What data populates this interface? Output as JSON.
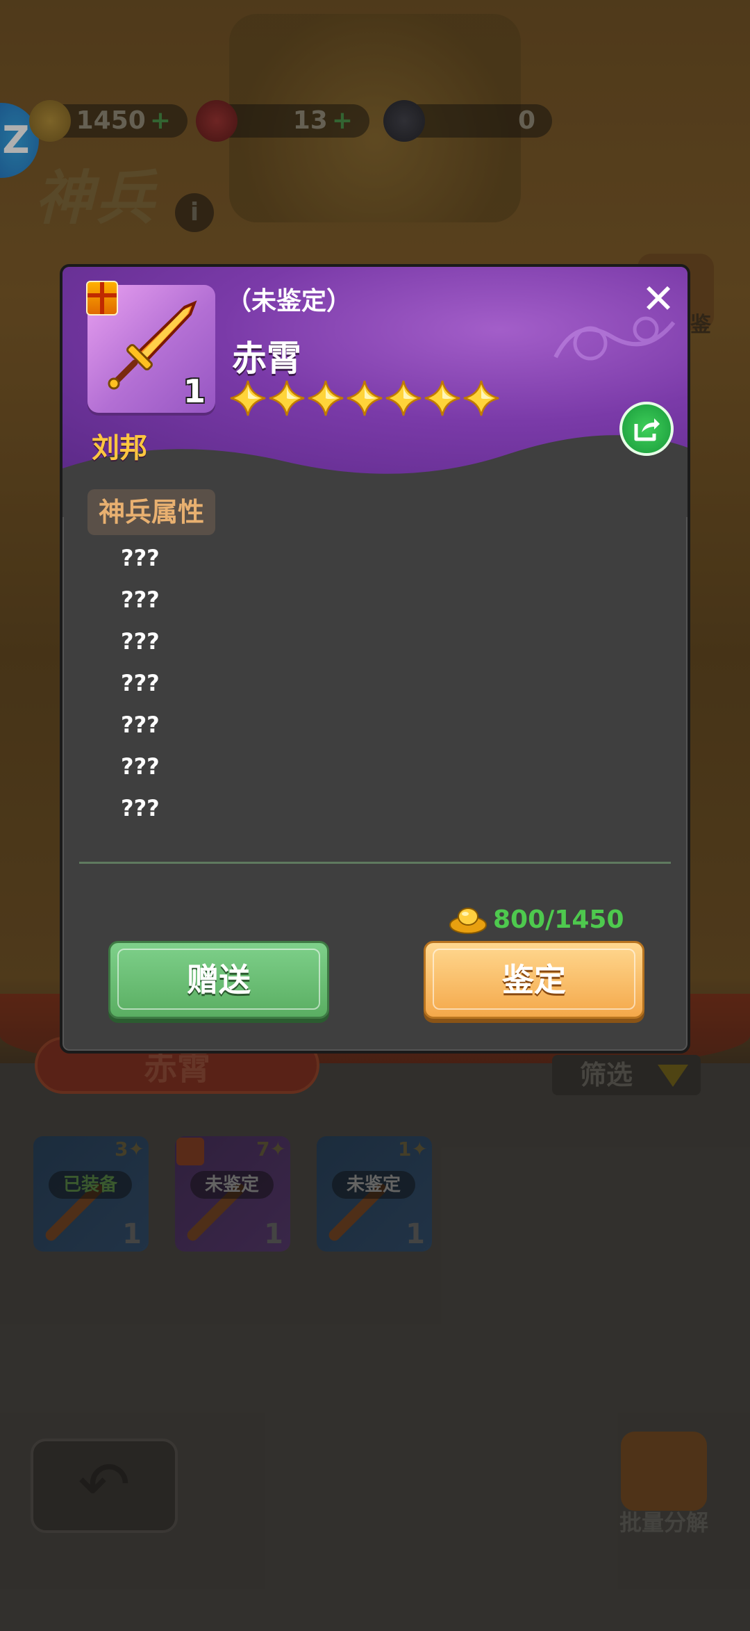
{
  "resources": {
    "gold": {
      "value": "1450",
      "icon": "gold-ingot-icon"
    },
    "gem": {
      "value": "13",
      "icon": "red-gem-icon"
    },
    "crystal": {
      "value": "0",
      "icon": "dark-crystal-icon"
    },
    "plus": "+"
  },
  "app_badge": "Z",
  "background": {
    "title": "神兵",
    "info": "i",
    "side_label": "图鉴",
    "weapon_name": "赤霄",
    "filter_label": "筛选",
    "bulk_label": "批量分解",
    "cards": [
      {
        "tag": "已装备",
        "stars": "3✦",
        "count": "1"
      },
      {
        "tag": "未鉴定",
        "stars": "7✦",
        "count": "1"
      },
      {
        "tag": "未鉴定",
        "stars": "1✦",
        "count": "1"
      }
    ]
  },
  "dialog": {
    "status": "（未鉴定）",
    "name": "赤霄",
    "item_count": "1",
    "owner": "刘邦",
    "star_count": 7,
    "section_title": "神兵属性",
    "attributes": [
      "???",
      "???",
      "???",
      "???",
      "???",
      "???",
      "???"
    ],
    "cost": "800/1450",
    "gift_button": "赠送",
    "identify_button": "鉴定",
    "close_glyph": "✕"
  },
  "colors": {
    "header_purple": "#7a3aa8",
    "owner_gold": "#ffc640",
    "cost_green": "#4ec94e",
    "gift_green": "#5aae62",
    "identify_orange": "#f4a84a"
  }
}
